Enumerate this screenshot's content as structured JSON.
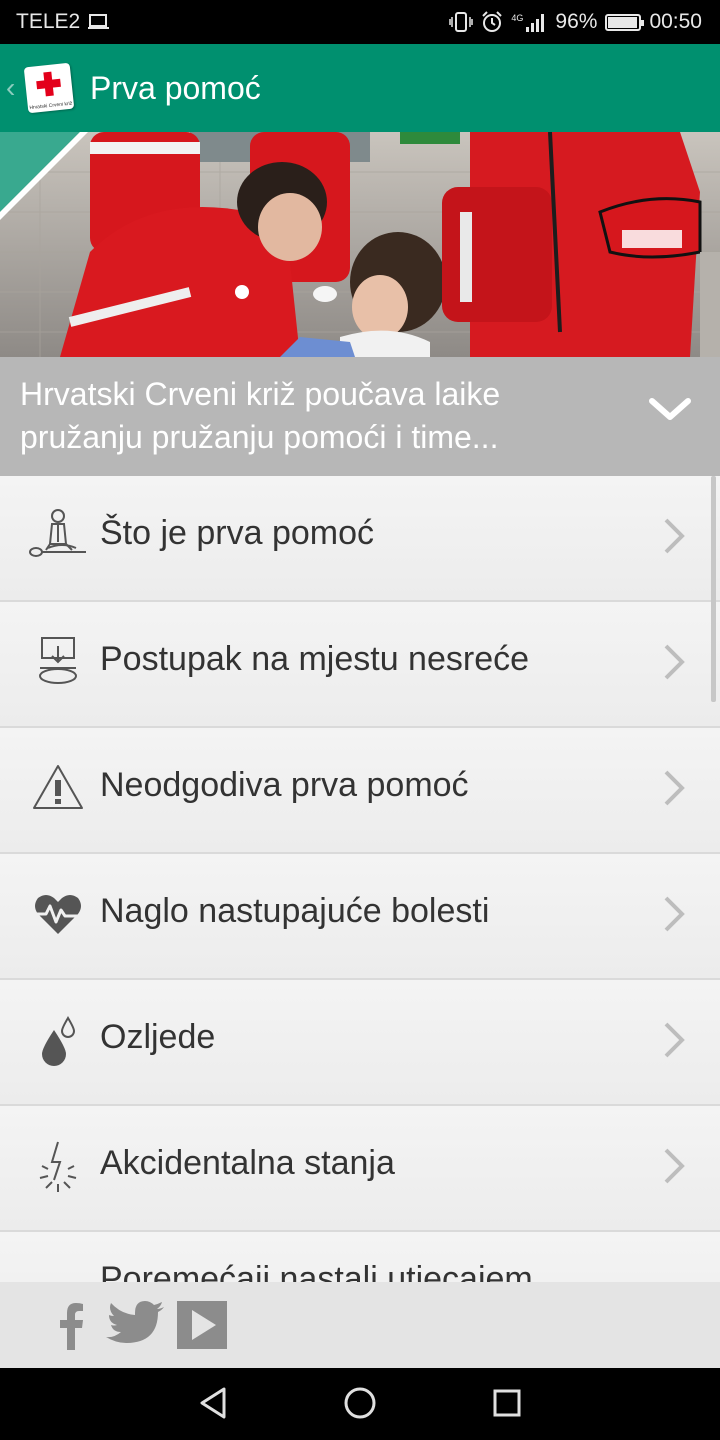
{
  "status_bar": {
    "carrier": "TELE2",
    "network": "4G",
    "battery_percent": "96%",
    "battery_level": 0.96,
    "time": "00:50",
    "icons": [
      "monitor-icon",
      "vibrate-icon",
      "alarm-icon",
      "signal-icon",
      "battery-icon"
    ]
  },
  "app_bar": {
    "title": "Prva pomoć",
    "logo_text": "Hrvatski Crveni križ",
    "color": "#00906f"
  },
  "caption": {
    "text": "Hrvatski Crveni križ poučava laike pružanju pružanju pomoći i time..."
  },
  "menu": {
    "items": [
      {
        "label": "Što je prva pomoć",
        "icon": "cpr-icon"
      },
      {
        "label": "Postupak na mjestu nesreće",
        "icon": "scene-icon"
      },
      {
        "label": "Neodgodiva prva pomoć",
        "icon": "warning-icon"
      },
      {
        "label": "Naglo nastupajuće bolesti",
        "icon": "heart-pulse-icon"
      },
      {
        "label": "Ozljede",
        "icon": "drops-icon"
      },
      {
        "label": "Akcidentalna stanja",
        "icon": "lightning-icon"
      },
      {
        "label": "Poremećaji nastali utjecajem",
        "icon": ""
      }
    ]
  },
  "social": {
    "icons": [
      "facebook-icon",
      "twitter-icon",
      "youtube-icon"
    ]
  },
  "nav": {
    "icons": [
      "back-icon",
      "home-icon",
      "recents-icon"
    ]
  },
  "colors": {
    "accent": "#00906f",
    "red_cross": "#e3001b",
    "caption_bg": "#b7b7b7"
  }
}
